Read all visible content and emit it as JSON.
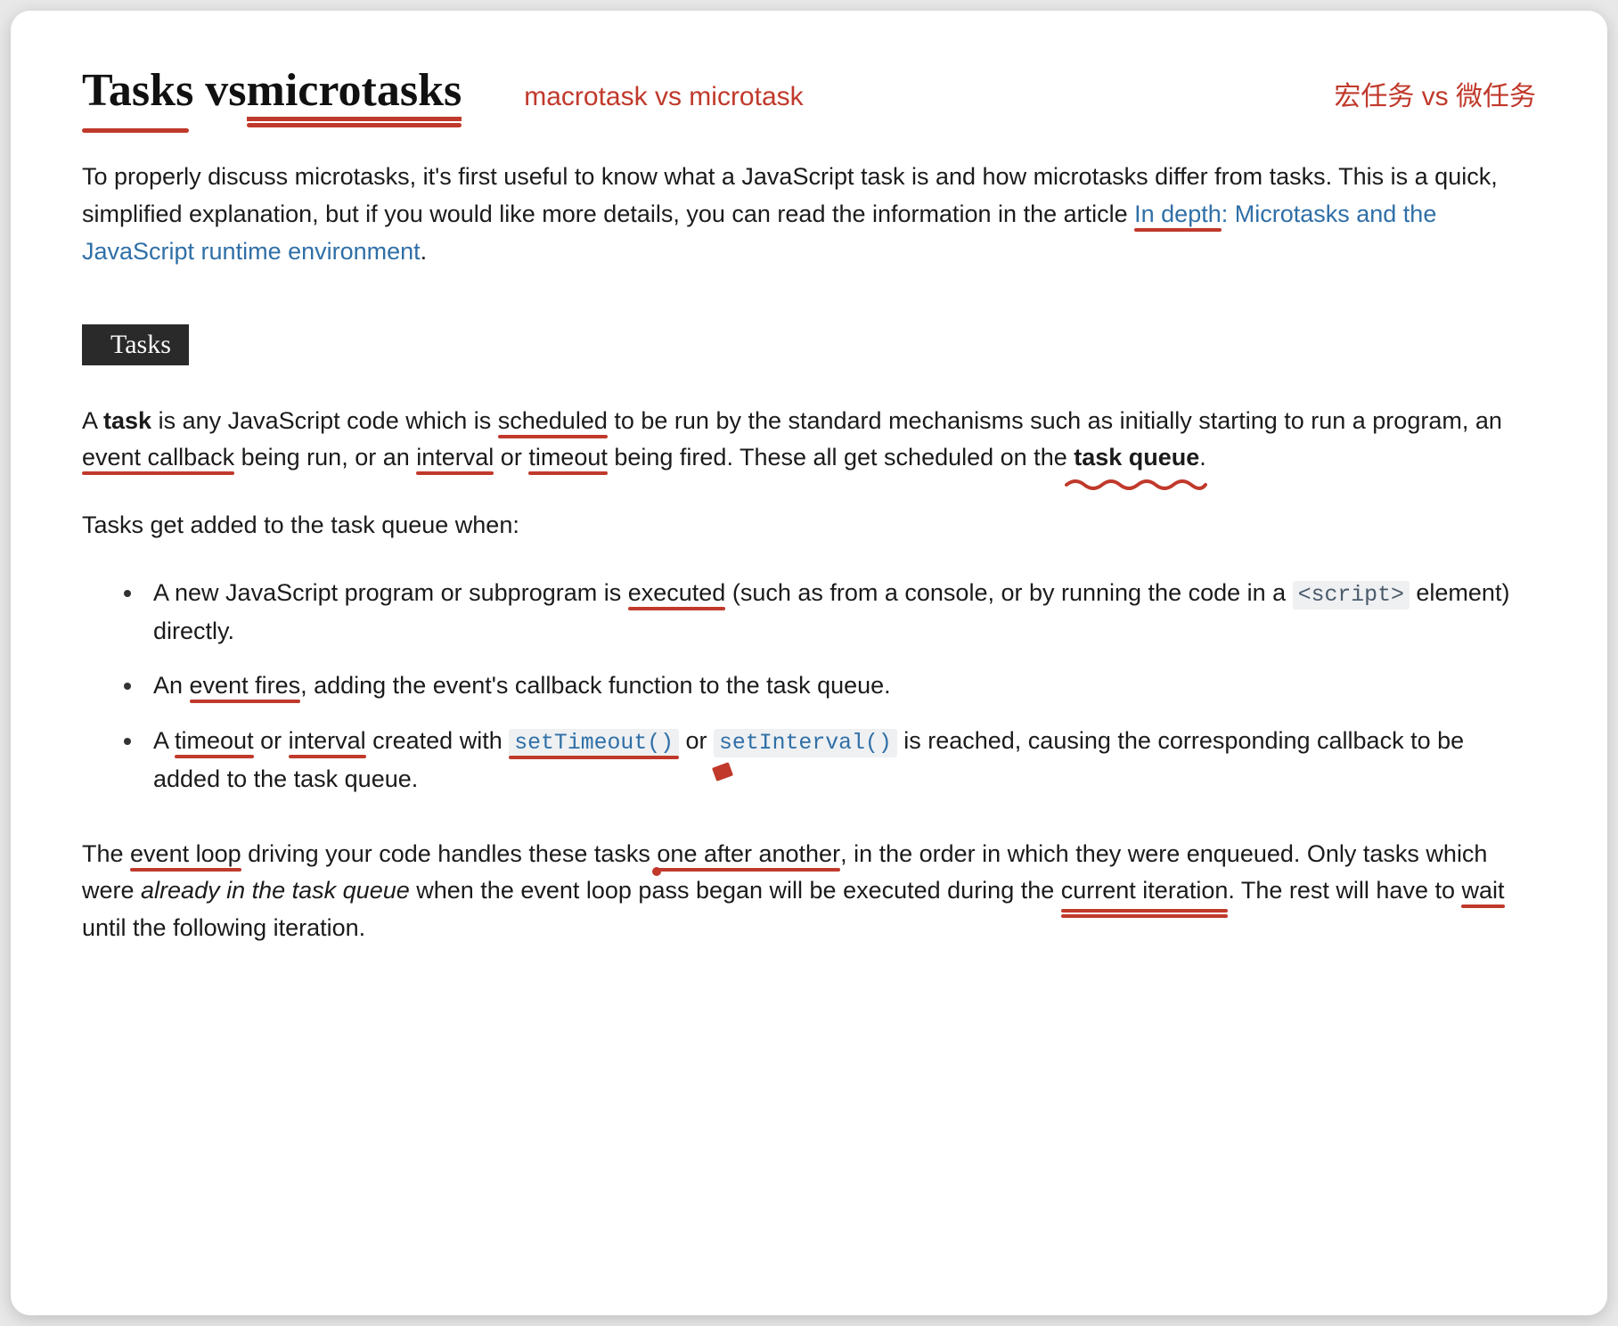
{
  "header": {
    "title_part1": "Tasks vs ",
    "title_part2": "microtasks",
    "annotation_en": "macrotask vs microtask",
    "annotation_cn": "宏任务 vs 微任务"
  },
  "intro": {
    "text_before_link": "To properly discuss microtasks, it's first useful to know what a JavaScript task is and how microtasks differ from tasks. This is a quick, simplified explanation, but if you would like more details, you can read the information in the article ",
    "link_underlined": "In depth",
    "link_rest": ": Microtasks and the JavaScript runtime environment",
    "text_after_link": "."
  },
  "section": {
    "label": "Tasks"
  },
  "para1": {
    "t1": "A ",
    "bold1": "task",
    "t2": " is any JavaScript code which is ",
    "u1": "scheduled",
    "t3": " to be run by the standard mechanisms such as initially starting to run a program, an ",
    "u2": "event callback",
    "t4": " being run, or an ",
    "u3": "interval",
    "t4a": " or ",
    "u4": "timeout",
    "t5": " being fired. These all get scheduled on the ",
    "bold2": "task queue",
    "t6": "."
  },
  "para2": "Tasks get added to the task queue when:",
  "bullets": {
    "b1": {
      "t1": "A new JavaScript program or subprogram is ",
      "u1": "executed",
      "t2": " (such as from a console, or by running the code in a ",
      "code1": "<script>",
      "t3": " element) directly."
    },
    "b2": {
      "t1": "An ",
      "u1": "event fires",
      "t2": ", adding the event's callback function to the task queue."
    },
    "b3": {
      "t1": "A ",
      "u1": "timeout",
      "t1a": " or ",
      "u2": "interval",
      "t2": " created with ",
      "code1": "setTimeout()",
      "t3": " or ",
      "code2": "setInterval()",
      "t4": " is reached, causing the corresponding callback to be added to the task queue."
    }
  },
  "para3": {
    "t1": "The ",
    "u1": "event loop",
    "t2": " driving your code handles these tasks ",
    "u2": "one after another",
    "t3": ", in the order in which they were enqueued. Only tasks which were ",
    "italic1": "already in the task queue",
    "t4": " when the event loop pass began will be executed during the ",
    "u3": "current iteration",
    "t5": ". The rest will have to ",
    "u4": "wait",
    "t6": " until the following iteration."
  }
}
